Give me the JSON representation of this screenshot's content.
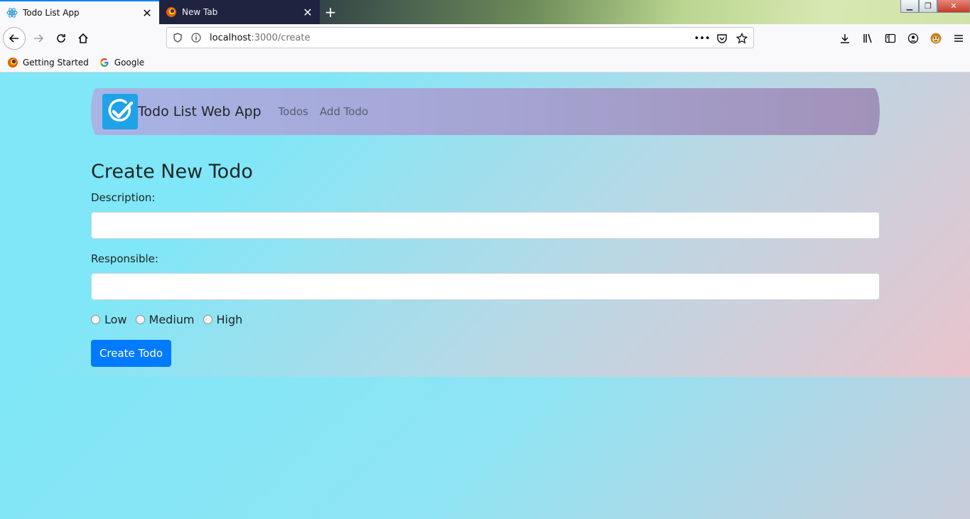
{
  "browser": {
    "tabs": [
      {
        "title": "Todo List App",
        "active": true
      },
      {
        "title": "New Tab",
        "active": false
      }
    ],
    "url": {
      "host": "localhost",
      "path": ":3000/create"
    },
    "bookmarks": [
      {
        "label": "Getting Started",
        "icon": "firefox-icon"
      },
      {
        "label": "Google",
        "icon": "google-icon"
      }
    ]
  },
  "app": {
    "brand": "Todo List Web App",
    "nav": [
      {
        "label": "Todos"
      },
      {
        "label": "Add Todo"
      }
    ],
    "heading": "Create New Todo",
    "form": {
      "description_label": "Description:",
      "description_value": "",
      "responsible_label": "Responsible:",
      "responsible_value": "",
      "priorities": [
        {
          "label": "Low",
          "checked": false
        },
        {
          "label": "Medium",
          "checked": false
        },
        {
          "label": "High",
          "checked": false
        }
      ],
      "submit_label": "Create Todo"
    }
  },
  "colors": {
    "accent": "#007bff",
    "logo": "#1ea3e8",
    "tab_indicator": "#0a84ff"
  }
}
